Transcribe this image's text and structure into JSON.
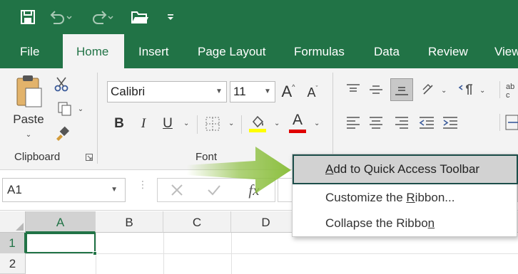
{
  "qat": {
    "icons": [
      "save-icon",
      "undo-icon",
      "redo-icon",
      "open-folder-icon",
      "customize-qat-icon"
    ]
  },
  "tabs": [
    {
      "label": "File",
      "active": false
    },
    {
      "label": "Home",
      "active": true
    },
    {
      "label": "Insert",
      "active": false
    },
    {
      "label": "Page Layout",
      "active": false
    },
    {
      "label": "Formulas",
      "active": false
    },
    {
      "label": "Data",
      "active": false
    },
    {
      "label": "Review",
      "active": false
    },
    {
      "label": "View",
      "active": false
    }
  ],
  "ribbon": {
    "clipboard": {
      "paste_label": "Paste",
      "group_label": "Clipboard"
    },
    "font": {
      "font_name": "Calibri",
      "font_size": "11",
      "bold": "B",
      "italic": "I",
      "underline": "U",
      "font_color_letter": "A",
      "grow_letter": "A",
      "shrink_letter": "A",
      "group_label": "Font",
      "highlight_color": "#ffff00",
      "font_color": "#e00000"
    }
  },
  "formula_bar": {
    "name_box": "A1",
    "fx": "fx"
  },
  "grid": {
    "columns": [
      "A",
      "B",
      "C",
      "D"
    ],
    "rows": [
      "1",
      "2"
    ]
  },
  "context_menu": {
    "items": [
      {
        "pre": "",
        "u": "A",
        "post": "dd to Quick Access Toolbar",
        "highlighted": true
      },
      {
        "pre": "Customize the ",
        "u": "R",
        "post": "ibbon...",
        "highlighted": false
      },
      {
        "pre": "Collapse the Ribbo",
        "u": "n",
        "post": "",
        "highlighted": false
      }
    ]
  },
  "colors": {
    "brand_green": "#217346",
    "arrow_green": "#8cbf3f"
  }
}
